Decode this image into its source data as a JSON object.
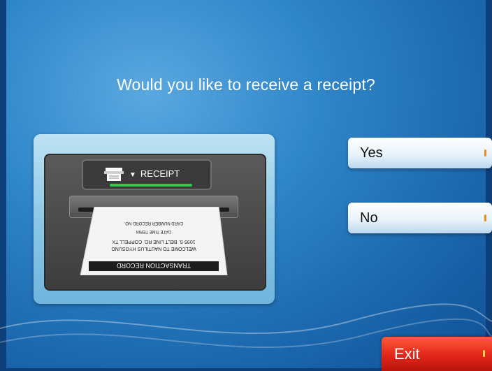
{
  "prompt": {
    "question": "Would you like to receive a receipt?"
  },
  "illustration": {
    "label": "RECEIPT",
    "label_arrow": "▼",
    "slip_lines": [
      "TRANSACTION RECORD",
      "WELCOME TO NAUTILUS HYOSUNG",
      "1095 S. BELT LINE RD. COPPELL TX",
      "DATE  TIME  TERM",
      "CARD NUMBER  RECORD NO."
    ]
  },
  "options": {
    "yes_label": "Yes",
    "no_label": "No",
    "exit_label": "Exit"
  },
  "colors": {
    "background": "#2f86c9",
    "exit_button": "#e3261a",
    "indicator_green": "#2ec84a",
    "indicator_orange": "#f08a1c"
  }
}
